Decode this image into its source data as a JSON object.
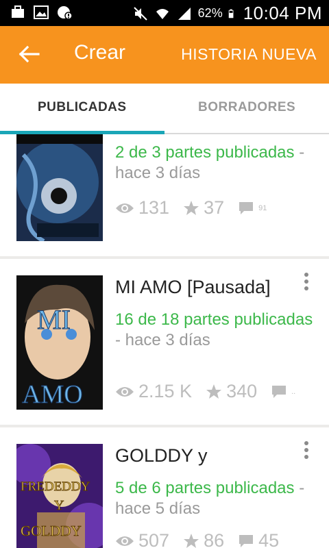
{
  "status_bar": {
    "battery": "62%",
    "time": "10:04 PM"
  },
  "toolbar": {
    "back_icon": "arrow-left-icon",
    "title": "Crear",
    "action": "HISTORIA NUEVA"
  },
  "tabs": [
    {
      "label": "PUBLICADAS",
      "active": true
    },
    {
      "label": "BORRADORES",
      "active": false
    }
  ],
  "stories": [
    {
      "title": "",
      "parts": "2 de 3 partes publicadas",
      "time": "- hace 3 días",
      "views": "131",
      "votes": "37",
      "comments": "91"
    },
    {
      "title": "MI AMO [Pausada]",
      "parts": "16 de 18 partes publicadas",
      "time": "- hace 3 días",
      "views": "2.15 K",
      "votes": "340",
      "comments": "..",
      "cover_text": [
        "MI",
        "AMO"
      ]
    },
    {
      "title": "GOLDDY y",
      "parts": "5 de 6 partes publicadas",
      "time": "- hace 5 días",
      "views": "507",
      "votes": "86",
      "comments": "45",
      "cover_text": [
        "FREDEDDY",
        "Y",
        "GOLDDY"
      ]
    }
  ],
  "colors": {
    "accent": "#f7931e",
    "green": "#3cb84a",
    "tab_indicator": "#1aa6b7"
  }
}
